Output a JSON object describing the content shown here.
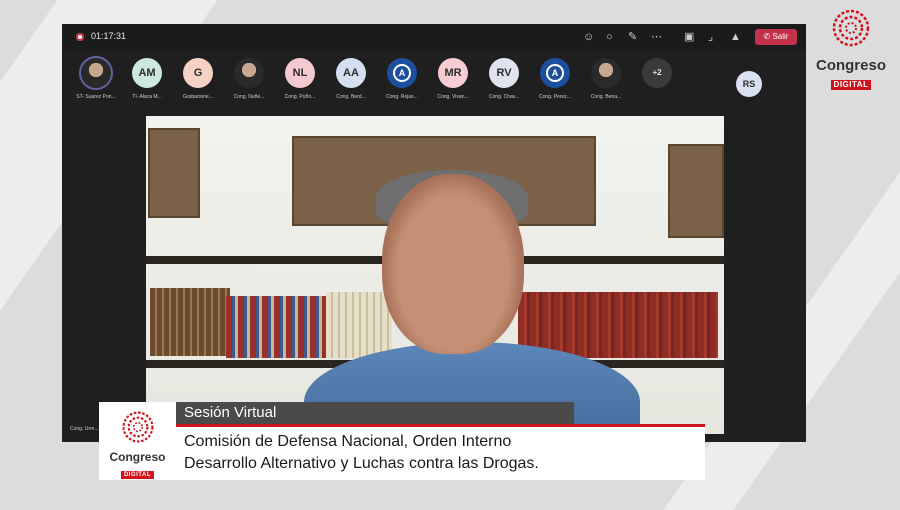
{
  "brand": {
    "word": "Congreso",
    "tag": "DIGITAL",
    "accent": "#d0121b"
  },
  "meeting": {
    "timer": "01:17:31",
    "leave_label": "Salir",
    "toolbar_icons": [
      "people-icon",
      "chat-icon",
      "react-icon",
      "more-icon",
      "camera-off-icon",
      "mic-off-icon",
      "share-icon"
    ],
    "participants": [
      {
        "initials": "",
        "name": "ST- Suarez Pon...",
        "kind": "photo"
      },
      {
        "initials": "AM",
        "name": "TI- Alaca M...",
        "color": "#cde8dc"
      },
      {
        "initials": "G",
        "name": "Grabacione...",
        "color": "#f6d2c4"
      },
      {
        "initials": "",
        "name": "Cong. Nuñe...",
        "kind": "photo"
      },
      {
        "initials": "NL",
        "name": "Cong. Puño...",
        "color": "#f4c9cf"
      },
      {
        "initials": "AA",
        "name": "Cong. Berd...",
        "color": "#d5dff2"
      },
      {
        "initials": "",
        "name": "Cong. Rojas...",
        "kind": "symbol"
      },
      {
        "initials": "MR",
        "name": "Cong. Vivan...",
        "color": "#f5cdd3"
      },
      {
        "initials": "RV",
        "name": "Cong. Chav...",
        "color": "#dfe3f0"
      },
      {
        "initials": "",
        "name": "Cong. Perez...",
        "kind": "symbol"
      },
      {
        "initials": "",
        "name": "Cong. Bena...",
        "kind": "photo"
      },
      {
        "initials": "+2",
        "name": "",
        "kind": "more"
      }
    ],
    "extra_participant": "RS",
    "speaker_label": "Cong. Urre..."
  },
  "lower_third": {
    "label": "Sesión Virtual",
    "line1": "Comisión de Defensa Nacional, Orden Interno",
    "line2": "Desarrollo Alternativo y Luchas contra las Drogas."
  }
}
